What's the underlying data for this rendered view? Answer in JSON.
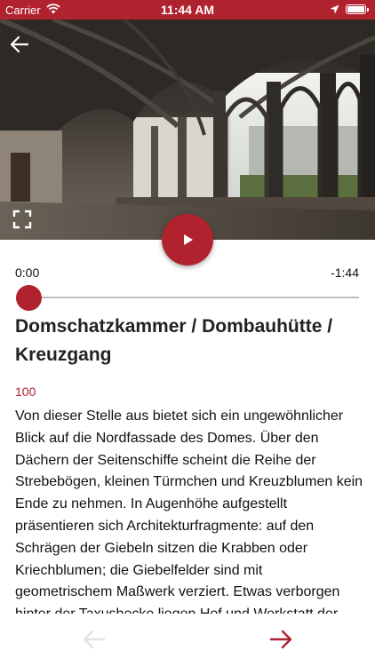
{
  "status_bar": {
    "carrier": "Carrier",
    "time": "11:44 AM"
  },
  "player": {
    "elapsed": "0:00",
    "remaining": "-1:44",
    "progress": 0
  },
  "stop": {
    "title": "Domschatzkammer / Dombauhütte / Kreuzgang",
    "number": "100",
    "description": "Von dieser Stelle aus bietet sich ein ungewöhnlicher Blick auf die Nordfassade des Domes. Über den Dächern der Seitenschiffe scheint die Reihe der Strebebögen, kleinen Türmchen und Kreuzblumen kein Ende zu nehmen. In Augenhöhe aufgestellt präsentieren sich Architekturfragmente: auf den Schrägen der Giebeln sitzen die Krabben oder Kriechblumen; die Giebelfelder sind mit geometrischem Maßwerk verziert. Etwas verborgen hinter der Taxushecke liegen Hof und Werkstatt der"
  },
  "colors": {
    "accent": "#b0222e",
    "track": "#bdbdbd",
    "nav_disabled": "#e3e3e3"
  },
  "icons": {
    "back": "arrow-left-icon",
    "fullscreen": "fullscreen-icon",
    "play": "play-icon",
    "prev": "arrow-left-icon",
    "next": "arrow-right-icon"
  }
}
